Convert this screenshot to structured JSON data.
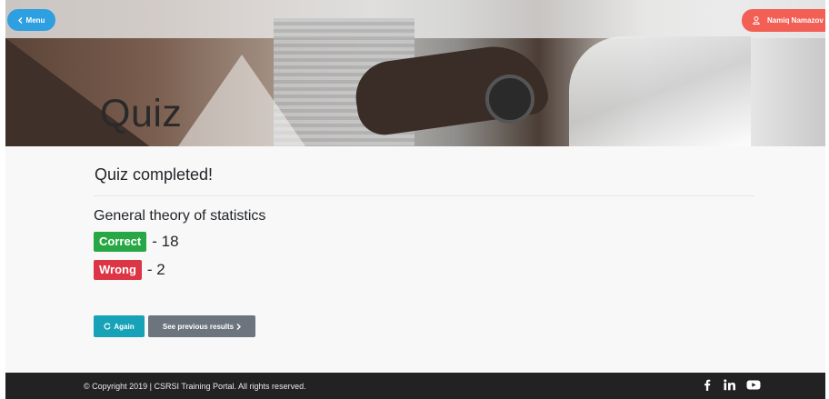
{
  "header": {
    "menu_label": "Menu",
    "user_name": "Namiq Namazov",
    "page_title": "Quiz"
  },
  "main": {
    "heading": "Quiz completed!",
    "quiz_name": "General theory of statistics",
    "results": {
      "correct_label": "Correct",
      "correct_value": "- 18",
      "wrong_label": "Wrong",
      "wrong_value": "- 2"
    },
    "buttons": {
      "again_label": "Again",
      "previous_label": "See previous results"
    }
  },
  "footer": {
    "copyright": "© Copyright 2019 | CSRSI Training Portal. All rights reserved.",
    "social_icons": [
      "facebook-icon",
      "linkedin-icon",
      "youtube-icon"
    ]
  },
  "colors": {
    "menu_button": "#2e9fe0",
    "user_button": "#f25f54",
    "correct_badge": "#28a745",
    "wrong_badge": "#dc3545",
    "again_button": "#17a2b8",
    "previous_button": "#6c757d",
    "footer": "#222222"
  }
}
